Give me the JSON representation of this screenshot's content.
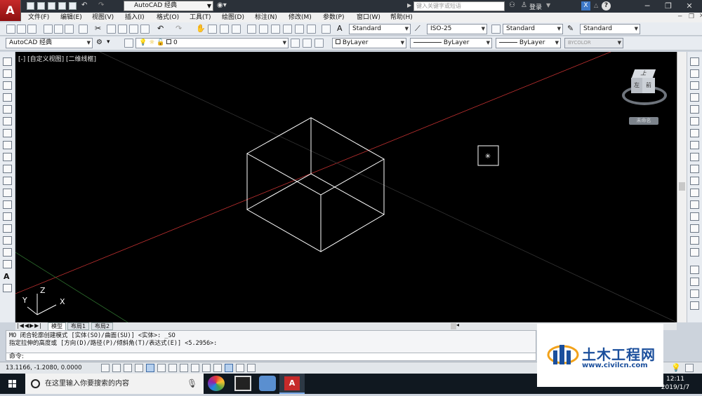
{
  "titlebar": {
    "app_letter": "A",
    "workspace": "AutoCAD 经典",
    "search_placeholder": "键入关键字或短语",
    "login": "登录",
    "help": "?"
  },
  "menu": [
    "文件(F)",
    "编辑(E)",
    "视图(V)",
    "插入(I)",
    "格式(O)",
    "工具(T)",
    "绘图(D)",
    "标注(N)",
    "修改(M)",
    "参数(P)",
    "窗口(W)",
    "帮助(H)"
  ],
  "styles_toolbar": {
    "text_style": "Standard",
    "dim_style": "ISO-25",
    "table_style": "Standard",
    "mleader_style": "Standard"
  },
  "layers_toolbar": {
    "workspace": "AutoCAD 经典",
    "layer": "0",
    "color": "ByLayer",
    "linetype": "ByLayer",
    "lineweight": "ByLayer",
    "plotstyle": "BYCOLOR"
  },
  "viewport": {
    "label": "[-] [自定义视图] [二维线框]",
    "ucs_z": "Z",
    "ucs_y": "Y",
    "ucs_x": "X",
    "viewcube_top": "上",
    "viewcube_left": "左",
    "viewcube_front": "前",
    "viewcube_wcs": "未命名"
  },
  "layout_tabs": [
    "模型",
    "布局1",
    "布局2"
  ],
  "command": {
    "line1": "MO 闭合轮廓创建模式 [实体(SO)/曲面(SU)] <实体>: _SO",
    "line2": "指定拉伸的高度或 [方向(D)/路径(P)/倾斜角(T)/表达式(E)] <5.2956>:",
    "prompt": "命令:"
  },
  "status": {
    "coords": "13.1166, -1.2080, 0.0000"
  },
  "taskbar": {
    "search_placeholder": "在这里输入你要搜索的内容",
    "time": "12:11",
    "date": "2019/1/7"
  },
  "watermark": {
    "title": "土木工程网",
    "url": "www.civilcn.com"
  },
  "colors": {
    "canvas": "#000000",
    "titlebar": "#2b3139",
    "accent_red": "#c62a2a",
    "watermark_blue": "#1b4f9c"
  }
}
